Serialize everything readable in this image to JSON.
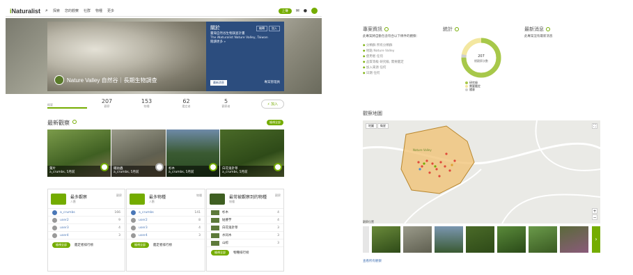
{
  "nav": {
    "logo": "Naturalist",
    "logo_i": "i",
    "items": [
      "探索",
      "您的觀察",
      "社群",
      "物種",
      "更多"
    ],
    "upload": "上傳"
  },
  "project": {
    "title": "Nature Valley 自然谷｜長期生物調查",
    "about_heading": "關於",
    "about_lines": [
      "臺灣自然谷生物調查計畫",
      "The iNaturalist Nature Valley, Taiwan",
      "閱讀更多 »"
    ],
    "btn_edit": "編輯",
    "btn_join": "加入",
    "news_btn": "最新消息",
    "admin": "專案管理員"
  },
  "stats": [
    {
      "n": "",
      "l": "概要"
    },
    {
      "n": "207",
      "l": "觀察"
    },
    {
      "n": "153",
      "l": "物種"
    },
    {
      "n": "62",
      "l": "鑑定者"
    },
    {
      "n": "5",
      "l": "觀察者"
    }
  ],
  "join_label": "加入",
  "recent": {
    "title": "最新觀察",
    "more": "檢視全部",
    "photos": [
      {
        "name": "葉片",
        "user": "a_crumbs, 5月前"
      },
      {
        "name": "蛾幼蟲",
        "user": "a_crumbs, 5月前"
      },
      {
        "name": "杉木",
        "user": "a_crumbs, 5月前"
      },
      {
        "name": "白花鬼針草",
        "user": "a_crumbs, 5月前"
      }
    ]
  },
  "panels": [
    {
      "title": "最多觀察",
      "sub": "人數",
      "count": "觀察",
      "rows": [
        {
          "name": "a_crumbs",
          "count": "166"
        },
        {
          "name": "user2",
          "count": "9"
        },
        {
          "name": "user3",
          "count": "4"
        },
        {
          "name": "user4",
          "count": "3"
        }
      ],
      "btn": "檢視全部",
      "link": "鑑定者排行榜"
    },
    {
      "title": "最多物種",
      "sub": "人數",
      "count": "物種",
      "rows": [
        {
          "name": "a_crumbs",
          "count": "141"
        },
        {
          "name": "user2",
          "count": "8"
        },
        {
          "name": "user3",
          "count": "4"
        },
        {
          "name": "user4",
          "count": "3"
        }
      ],
      "btn": "檢視全部",
      "link": "鑑定者排行榜"
    },
    {
      "title": "最常被觀察到的物種",
      "sub": "物種",
      "count": "觀察",
      "rows": [
        {
          "name": "杉木",
          "count": "4"
        },
        {
          "name": "姑婆芋",
          "count": "4"
        },
        {
          "name": "白花鬼針草",
          "count": "3"
        },
        {
          "name": "水同木",
          "count": "3"
        },
        {
          "name": "山棕",
          "count": "3"
        }
      ],
      "btn": "檢視全部",
      "link": "物種排行榜"
    }
  ],
  "right": {
    "details_title": "專案資訊",
    "details_sub": "此專案將自動包含符合以下條件的觀察：",
    "details": [
      {
        "k": "分類群",
        "v": "所有分類群"
      },
      {
        "k": "地點",
        "v": "Nature Valley"
      },
      {
        "k": "使用者",
        "v": "任何"
      },
      {
        "k": "品質等級",
        "v": "研究級, 需要鑑定"
      },
      {
        "k": "加入來源",
        "v": "任何"
      },
      {
        "k": "日期",
        "v": "任何"
      }
    ],
    "stats_title": "統計",
    "donut_center": "207",
    "donut_label": "總觀察次數",
    "legend": [
      "研究級",
      "需要鑑定",
      "隨意"
    ],
    "news_title": "最新消息",
    "news_empty": "此專案沒有最新消息",
    "map_title": "觀察地圖",
    "map_btns": [
      "地圖",
      "衛星"
    ],
    "map_label": "Nature Valley",
    "map_caption": "觀察位置",
    "bottom_link": "查看所有觀察"
  },
  "colors": {
    "accent": "#74ac00",
    "about": "#2c4d7e",
    "polygon": "#f0c070"
  }
}
